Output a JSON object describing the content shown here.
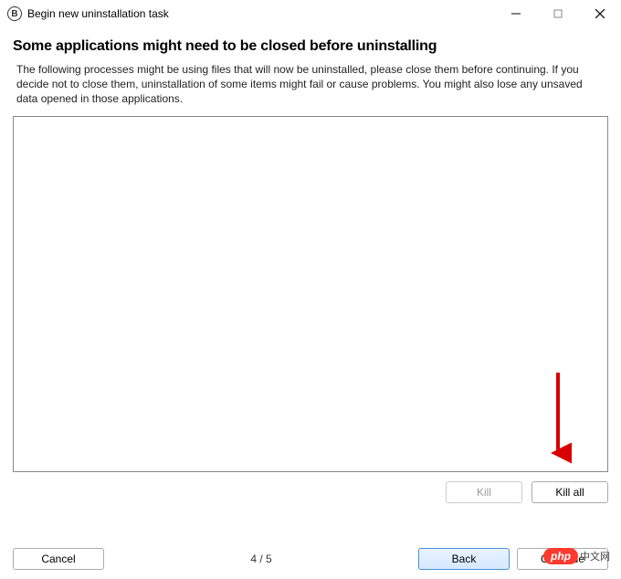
{
  "titlebar": {
    "icon_letter": "B",
    "title": "Begin new uninstallation task"
  },
  "heading": "Some applications might need to be closed before uninstalling",
  "description": "The following processes might be using files that will now be uninstalled, please close them before continuing. If you decide not to close them, uninstallation of some items might fail or cause problems. You might also lose any unsaved data opened in those applications.",
  "buttons": {
    "kill": "Kill",
    "killall": "Kill all",
    "cancel": "Cancel",
    "back": "Back",
    "continue": "Continue"
  },
  "progress": "4 / 5",
  "watermark": {
    "bubble": "php",
    "text": "中文网"
  }
}
